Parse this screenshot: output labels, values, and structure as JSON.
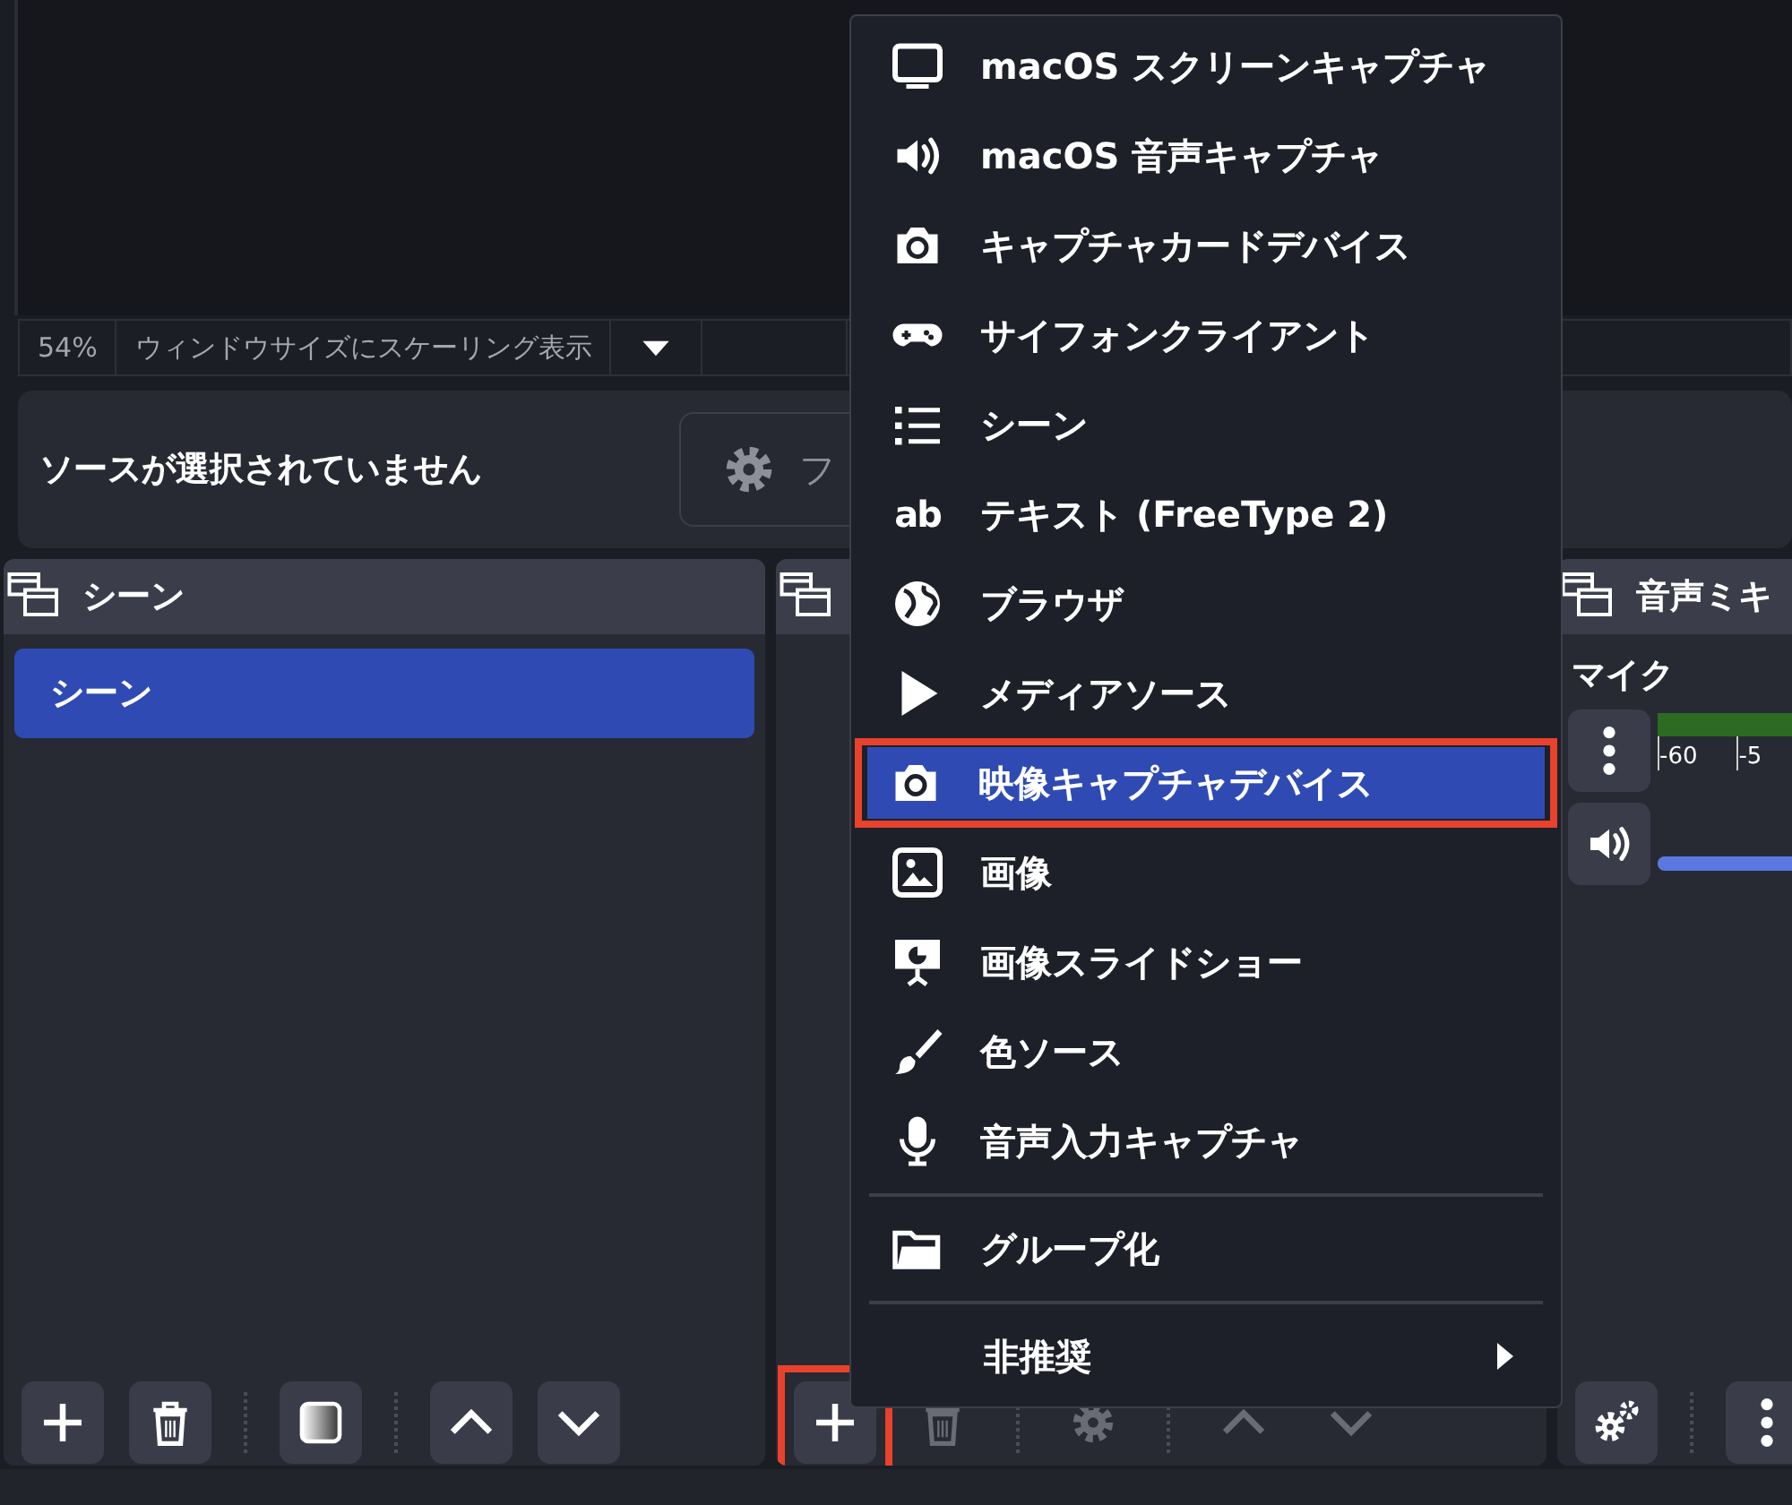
{
  "status_bar": {
    "zoom": "54%",
    "scale_mode": "ウィンドウサイズにスケーリング表示"
  },
  "context_bar": {
    "message": "ソースが選択されていません",
    "properties_button": "フ"
  },
  "scenes_dock": {
    "title": "シーン",
    "items": [
      {
        "label": "シーン",
        "selected": true
      }
    ],
    "buttons": [
      {
        "kind": "plus",
        "disabled": false,
        "highlighted": false
      },
      {
        "kind": "trash",
        "disabled": false,
        "highlighted": false
      },
      {
        "kind": "separator"
      },
      {
        "kind": "filter",
        "disabled": false,
        "highlighted": false
      },
      {
        "kind": "separator"
      },
      {
        "kind": "up",
        "disabled": false,
        "highlighted": false
      },
      {
        "kind": "down",
        "disabled": false,
        "highlighted": false
      }
    ]
  },
  "sources_dock": {
    "buttons": [
      {
        "kind": "plus",
        "disabled": false,
        "highlighted": true
      },
      {
        "kind": "trash",
        "disabled": true,
        "highlighted": false
      },
      {
        "kind": "separator"
      },
      {
        "kind": "gear",
        "disabled": true,
        "highlighted": false
      },
      {
        "kind": "separator"
      },
      {
        "kind": "up",
        "disabled": true,
        "highlighted": false
      },
      {
        "kind": "down",
        "disabled": true,
        "highlighted": false
      }
    ]
  },
  "mixer_dock": {
    "title": "音声ミキ",
    "channel": {
      "name": "マイク",
      "ticks": [
        "-60",
        "-5"
      ],
      "volume": {
        "level": 1
      }
    },
    "buttons": [
      {
        "kind": "gears",
        "disabled": false,
        "highlighted": false
      },
      {
        "kind": "separator"
      },
      {
        "kind": "dots",
        "disabled": false,
        "highlighted": false
      }
    ]
  },
  "context_menu": {
    "items": [
      {
        "kind": "monitor",
        "label": "macOS スクリーンキャプチャ",
        "selected": false,
        "highlighted": false
      },
      {
        "kind": "speaker",
        "label": "macOS 音声キャプチャ",
        "selected": false,
        "highlighted": false
      },
      {
        "kind": "camera",
        "label": "キャプチャカードデバイス",
        "selected": false,
        "highlighted": false
      },
      {
        "kind": "gamepad",
        "label": "サイフォンクライアント",
        "selected": false,
        "highlighted": false
      },
      {
        "kind": "list",
        "label": "シーン",
        "selected": false,
        "highlighted": false
      },
      {
        "kind": "text",
        "icon_text": "ab",
        "label": "テキスト (FreeType 2)",
        "selected": false,
        "highlighted": false
      },
      {
        "kind": "globe",
        "label": "ブラウザ",
        "selected": false,
        "highlighted": false
      },
      {
        "kind": "play",
        "label": "メディアソース",
        "selected": false,
        "highlighted": false
      },
      {
        "kind": "camera",
        "label": "映像キャプチャデバイス",
        "selected": true,
        "highlighted": true
      },
      {
        "kind": "image",
        "label": "画像",
        "selected": false,
        "highlighted": false
      },
      {
        "kind": "slideshow",
        "label": "画像スライドショー",
        "selected": false,
        "highlighted": false
      },
      {
        "kind": "brush",
        "label": "色ソース",
        "selected": false,
        "highlighted": false
      },
      {
        "kind": "mic",
        "label": "音声入力キャプチャ",
        "selected": false,
        "highlighted": false
      },
      {
        "kind": "separator"
      },
      {
        "kind": "folder",
        "label": "グループ化",
        "selected": false,
        "highlighted": false
      },
      {
        "kind": "separator"
      },
      {
        "kind": "submenu",
        "label": "非推奨",
        "selected": false,
        "highlighted": false
      }
    ]
  }
}
